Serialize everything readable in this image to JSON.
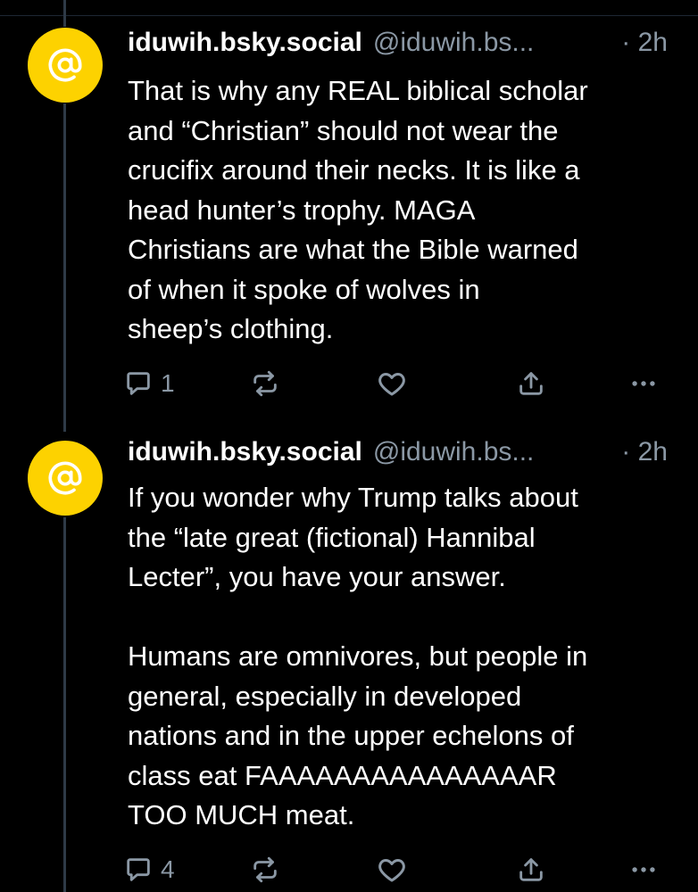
{
  "posts": [
    {
      "avatar_glyph": "at-sign",
      "display_name": "iduwih.bsky.social",
      "handle": "@iduwih.bs...",
      "time": "· 2h",
      "text": "That is why any REAL biblical scholar\nand “Christian” should not wear the\ncrucifix around their necks. It is like a\nhead hunter’s trophy. MAGA\nChristians are what the Bible warned\nof when it spoke of wolves in\nsheep’s clothing.",
      "actions": {
        "reply_count": "1",
        "repost_icon": "repost-icon",
        "like_icon": "heart-icon",
        "share_icon": "share-icon",
        "more_icon": "more-icon"
      }
    },
    {
      "avatar_glyph": "at-sign",
      "display_name": "iduwih.bsky.social",
      "handle": "@iduwih.bs...",
      "time": "· 2h",
      "text": "If you wonder why Trump talks about\nthe “late great  (fictional) Hannibal\nLecter”, you have your answer.\n\nHumans are omnivores, but people in\ngeneral, especially in developed\nnations and in the upper echelons of\nclass eat FAAAAAAAAAAAAAAAR\nTOO MUCH meat.",
      "actions": {
        "reply_count": "4",
        "repost_icon": "repost-icon",
        "like_icon": "heart-icon",
        "share_icon": "share-icon",
        "more_icon": "more-icon"
      }
    }
  ],
  "colors": {
    "background": "#000000",
    "avatar": "#fdd200",
    "text_primary": "#ffffff",
    "text_secondary": "#8b98a5",
    "thread_line": "#2e3a47"
  }
}
